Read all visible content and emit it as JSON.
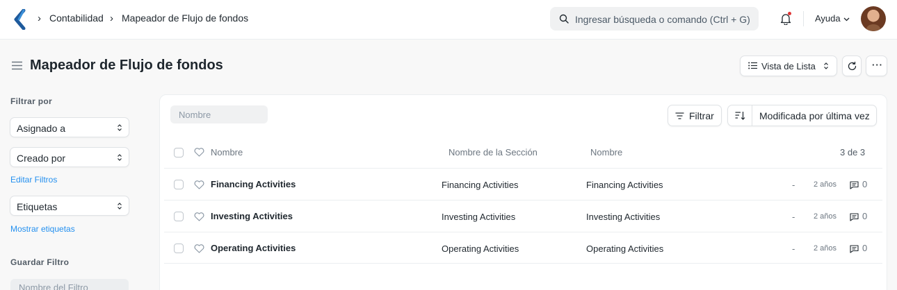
{
  "navbar": {
    "breadcrumbs": [
      "Contabilidad",
      "Mapeador de Flujo de fondos"
    ],
    "search_placeholder": "Ingresar búsqueda o comando (Ctrl + G)",
    "help_label": "Ayuda",
    "icons": {
      "logo": "frappe-logo",
      "search": "search-icon",
      "notifications": "bell-icon",
      "avatar": "user-avatar"
    }
  },
  "page": {
    "title": "Mapeador de Flujo de fondos",
    "view_label": "Vista de Lista"
  },
  "sidebar": {
    "filter_heading": "Filtrar por",
    "filters": [
      "Asignado a",
      "Creado por"
    ],
    "edit_filters_link": "Editar Filtros",
    "tags_select": "Etiquetas",
    "show_tags_link": "Mostrar etiquetas",
    "save_filter_heading": "Guardar Filtro",
    "filter_name_placeholder": "Nombre del Filtro"
  },
  "list": {
    "name_filter_placeholder": "Nombre",
    "filter_button": "Filtrar",
    "sort_label": "Modificada por última vez",
    "columns": [
      "Nombre",
      "Nombre de la Sección",
      "Nombre"
    ],
    "count": "3 de 3",
    "rows": [
      {
        "title": "Financing Activities",
        "section": "Financing Activities",
        "name": "Financing Activities",
        "dash": "-",
        "modified": "2 años",
        "comments": "0"
      },
      {
        "title": "Investing Activities",
        "section": "Investing Activities",
        "name": "Investing Activities",
        "dash": "-",
        "modified": "2 años",
        "comments": "0"
      },
      {
        "title": "Operating Activities",
        "section": "Operating Activities",
        "name": "Operating Activities",
        "dash": "-",
        "modified": "2 años",
        "comments": "0"
      }
    ]
  },
  "colors": {
    "accent_link": "#2490ef",
    "logo": "#1e5a9c",
    "text": "#1f272e"
  }
}
